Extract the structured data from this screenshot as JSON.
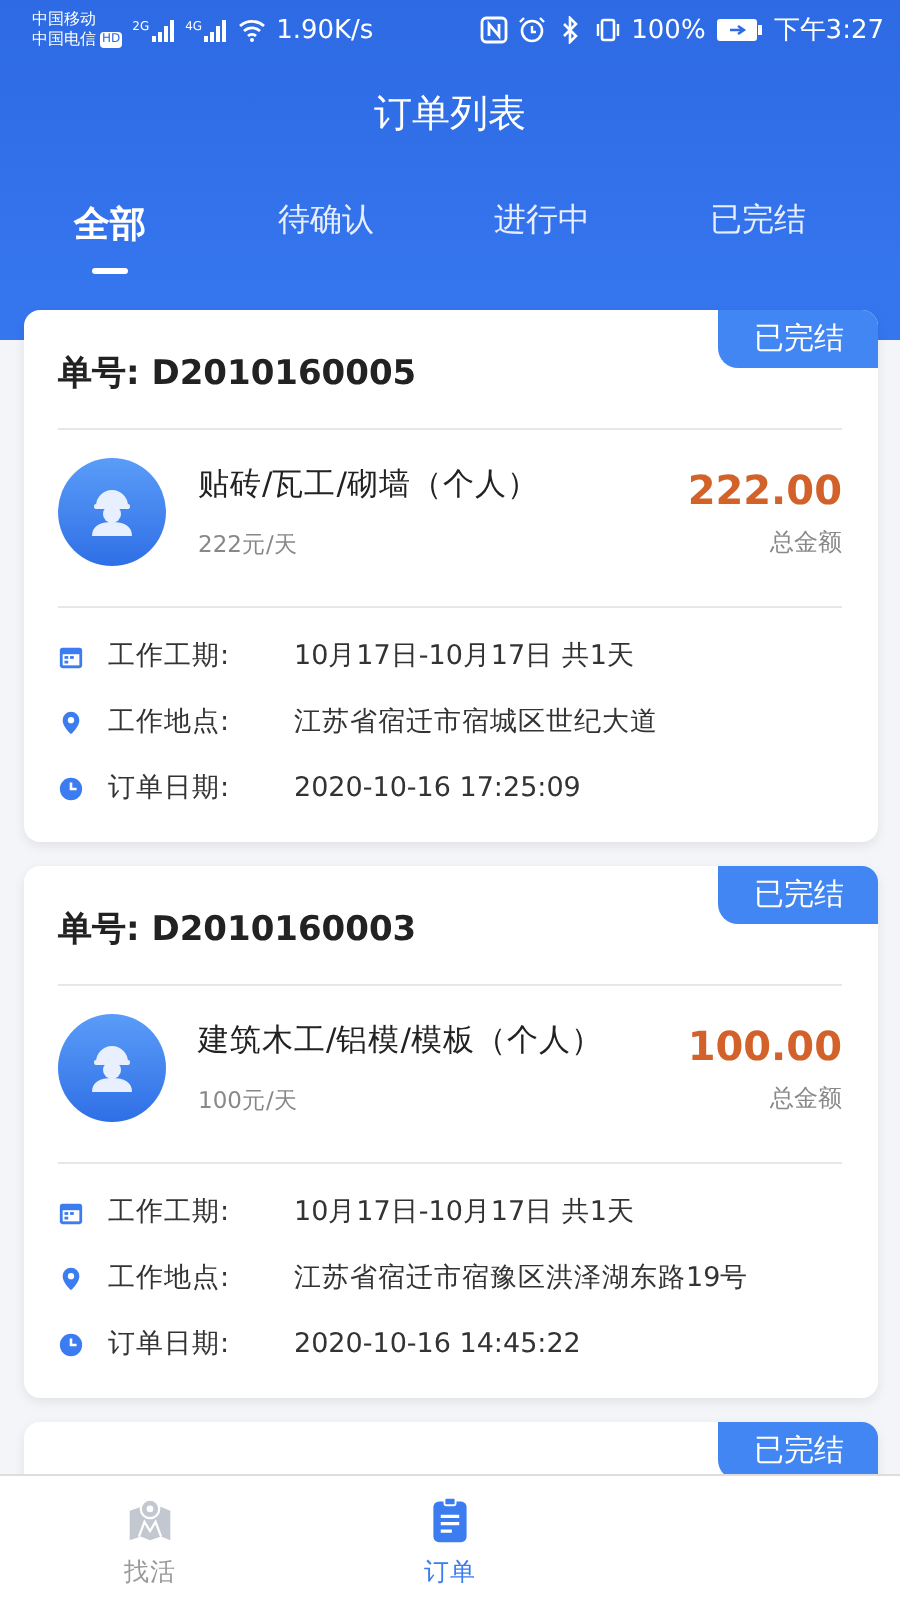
{
  "status_bar": {
    "carrier_1": "中国移动",
    "carrier_2": "中国电信",
    "hd": "HD",
    "net_1": "2G",
    "net_2": "4G",
    "speed": "1.90K/s",
    "battery": "100%",
    "time": "下午3:27"
  },
  "title": "订单列表",
  "tabs": [
    {
      "label": "全部",
      "selected": true
    },
    {
      "label": "待确认",
      "selected": false
    },
    {
      "label": "进行中",
      "selected": false
    },
    {
      "label": "已完结",
      "selected": false
    }
  ],
  "orders": [
    {
      "number": "单号: D2010160005",
      "status": "已完结",
      "job": "贴砖/瓦工/砌墙（个人）",
      "rate": "222元/天",
      "amount": "222.00",
      "amount_label": "总金额",
      "details": [
        {
          "kind": "calendar",
          "label": "工作工期:",
          "value": "10月17日-10月17日 共1天"
        },
        {
          "kind": "location",
          "label": "工作地点:",
          "value": "江苏省宿迁市宿城区世纪大道"
        },
        {
          "kind": "clock",
          "label": "订单日期:",
          "value": "2020-10-16 17:25:09"
        }
      ]
    },
    {
      "number": "单号: D2010160003",
      "status": "已完结",
      "job": "建筑木工/铝模/模板（个人）",
      "rate": "100元/天",
      "amount": "100.00",
      "amount_label": "总金额",
      "details": [
        {
          "kind": "calendar",
          "label": "工作工期:",
          "value": "10月17日-10月17日 共1天"
        },
        {
          "kind": "location",
          "label": "工作地点:",
          "value": "江苏省宿迁市宿豫区洪泽湖东路19号"
        },
        {
          "kind": "clock",
          "label": "订单日期:",
          "value": "2020-10-16 14:45:22"
        }
      ]
    },
    {
      "status": "已完结"
    }
  ],
  "bottom_nav": [
    {
      "kind": "map",
      "label": "找活",
      "selected": false
    },
    {
      "kind": "clipboard",
      "label": "订单",
      "selected": true
    }
  ]
}
